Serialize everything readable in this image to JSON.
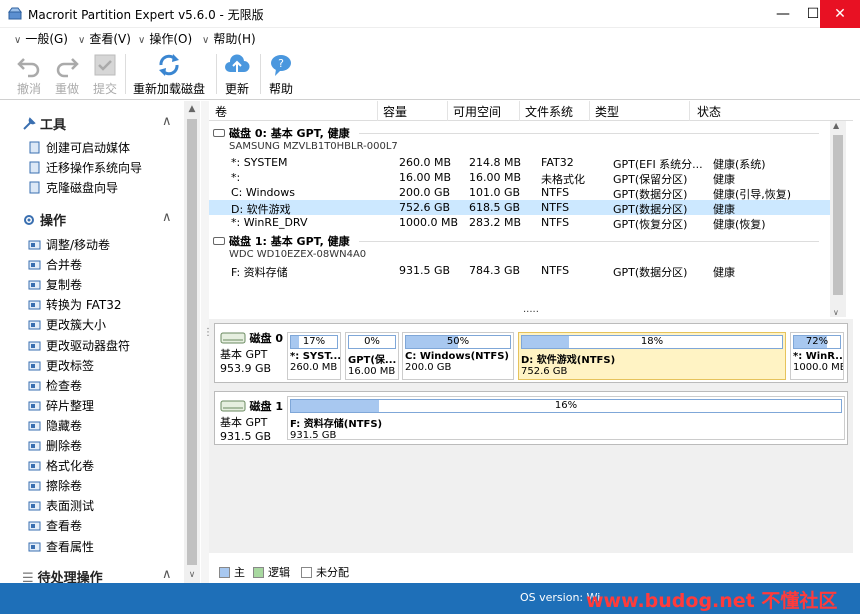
{
  "window": {
    "title": "Macrorit Partition Expert v5.6.0 - 无限版",
    "min": "—",
    "max": "☐",
    "close": "✕"
  },
  "menu": [
    "一般(G)",
    "查看(V)",
    "操作(O)",
    "帮助(H)"
  ],
  "toolbar": {
    "undo": "撤消",
    "redo": "重做",
    "commit": "提交",
    "reload": "重新加载磁盘",
    "update": "更新",
    "help": "帮助"
  },
  "left_panel": {
    "tools_title": "工具",
    "tools": [
      "创建可启动媒体",
      "迁移操作系统向导",
      "克隆磁盘向导"
    ],
    "ops_title": "操作",
    "ops": [
      "调整/移动卷",
      "合并卷",
      "复制卷",
      "转换为 FAT32",
      "更改簇大小",
      "更改驱动器盘符",
      "更改标签",
      "检查卷",
      "碎片整理",
      "隐藏卷",
      "删除卷",
      "格式化卷",
      "擦除卷",
      "表面测试",
      "查看卷",
      "查看属性"
    ],
    "pending_title": "待处理操作"
  },
  "table": {
    "columns": [
      "卷",
      "容量",
      "可用空间",
      "文件系统",
      "类型",
      "状态"
    ],
    "disks": [
      {
        "header": "磁盘  0: 基本 GPT, 健康",
        "model": "SAMSUNG MZVLB1T0HBLR-000L7",
        "rows": [
          {
            "vol": "*: SYSTEM",
            "cap": "260.0 MB",
            "free": "214.8 MB",
            "fs": "FAT32",
            "type": "GPT(EFI 系统分...",
            "status": "健康(系统)"
          },
          {
            "vol": "*:",
            "cap": "16.00 MB",
            "free": "16.00 MB",
            "fs": "未格式化",
            "type": "GPT(保留分区)",
            "status": "健康"
          },
          {
            "vol": "C: Windows",
            "cap": "200.0 GB",
            "free": "101.0 GB",
            "fs": "NTFS",
            "type": "GPT(数据分区)",
            "status": "健康(引导,恢复)"
          },
          {
            "vol": "D: 软件游戏",
            "cap": "752.6 GB",
            "free": "618.5 GB",
            "fs": "NTFS",
            "type": "GPT(数据分区)",
            "status": "健康"
          },
          {
            "vol": "*: WinRE_DRV",
            "cap": "1000.0 MB",
            "free": "283.2 MB",
            "fs": "NTFS",
            "type": "GPT(恢复分区)",
            "status": "健康(恢复)"
          }
        ]
      },
      {
        "header": "磁盘  1: 基本 GPT, 健康",
        "model": "WDC WD10EZEX-08WN4A0",
        "rows": [
          {
            "vol": "F: 资料存储",
            "cap": "931.5 GB",
            "free": "784.3 GB",
            "fs": "NTFS",
            "type": "GPT(数据分区)",
            "status": "健康"
          }
        ]
      }
    ],
    "more": "....."
  },
  "diskmap": {
    "disks": [
      {
        "name": "磁盘  0",
        "kind": "基本 GPT",
        "size": "953.9 GB",
        "parts": [
          {
            "pct": "17%",
            "fill": 0.17,
            "name": "*: SYST...",
            "size": "260.0 MB"
          },
          {
            "pct": "0%",
            "fill": 0.0,
            "name": "GPT(保...",
            "size": "16.00 MB"
          },
          {
            "pct": "50%",
            "fill": 0.5,
            "name": "C: Windows(NTFS)",
            "size": "200.0 GB"
          },
          {
            "pct": "18%",
            "fill": 0.18,
            "name": "D: 软件游戏(NTFS)",
            "size": "752.6 GB"
          },
          {
            "pct": "72%",
            "fill": 0.72,
            "name": "*: WinR...",
            "size": "1000.0 MB"
          }
        ]
      },
      {
        "name": "磁盘  1",
        "kind": "基本 GPT",
        "size": "931.5 GB",
        "parts": [
          {
            "pct": "16%",
            "fill": 0.16,
            "name": "F: 资料存储(NTFS)",
            "size": "931.5 GB"
          }
        ]
      }
    ]
  },
  "legend": {
    "primary": "主",
    "logical": "逻辑",
    "unalloc": "未分配",
    "primary_color": "#a8c8f0",
    "logical_color": "#a8d8a0",
    "unalloc_color": "#ffffff"
  },
  "status": {
    "os": "OS version: Wi",
    "watermark": "www.budog.net 不懂社区"
  }
}
